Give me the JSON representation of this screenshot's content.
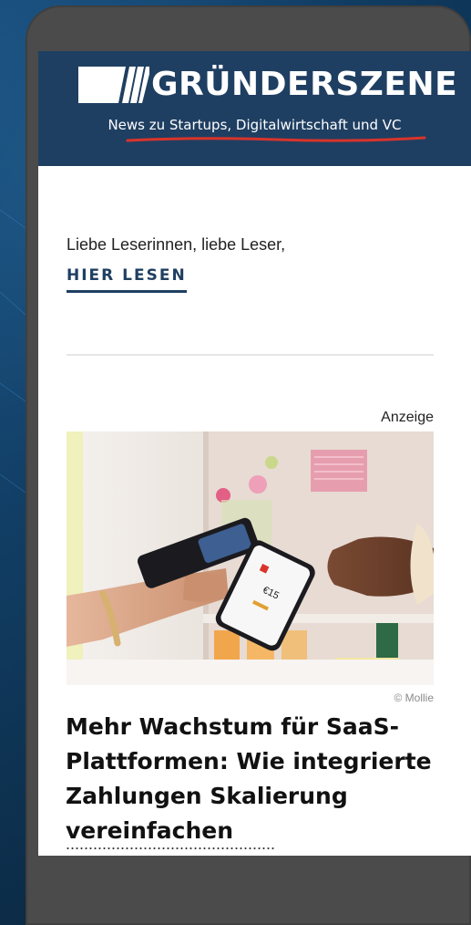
{
  "header": {
    "logo_text": "GRÜNDERSZENE",
    "tagline": "News zu Startups, Digitalwirtschaft und VC"
  },
  "content": {
    "greeting": "Liebe Leserinnen, liebe Leser,",
    "read_link": "HIER LESEN",
    "ad_label": "Anzeige",
    "image_credit": "© Mollie",
    "headline": "Mehr Wachstum für SaaS-Plattformen: Wie integrierte Zahlungen Skalierung vereinfachen",
    "phone_amount": "€15"
  },
  "colors": {
    "header_bg": "#1f3f62",
    "accent_red": "#d9342b",
    "link_color": "#1f3f62",
    "page_bg": "#0d3558"
  },
  "icons": [
    "gruenderszene-logo-icon",
    "red-underline-swoosh-icon"
  ]
}
